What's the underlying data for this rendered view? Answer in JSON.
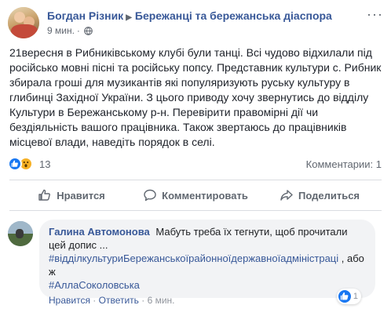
{
  "post": {
    "author": "Богдан Різник",
    "group": "Бережанці та бережанська діаспора",
    "time": "9 мин.",
    "text": "21вересня в Рибниківському клубі були танці. Всі чудово відхилали під російсько мовні пісні та російську попсу. Представник культури с. Рибник збирала гроші для музикантів які популяризують руську культуру в глибинці Західної України. З цього приводу хочу звернутись до відділу Культури в Бережанському р-н. Перевірити правомірні дії чи бездіяльність вашого працівника. Також звертаюсь до працівників місцевої влади, наведіть порядок в селі.",
    "reaction_count": "13",
    "comments_label": "Комментарии: 1"
  },
  "actions": {
    "like": "Нравится",
    "comment": "Комментировать",
    "share": "Поделиться"
  },
  "comment": {
    "author": "Галина Автомонова",
    "text": "Мабуть треба їх тегнути, щоб прочитали цей допис ...",
    "hashtag1": "#відділкультуриБережанськоїрайонноїдержавноїадміністраці",
    "text2": " , або ж",
    "hashtag2": "#АллаСоколовська",
    "like_link": "Нравится",
    "reply_link": "Ответить",
    "time": "6 мин.",
    "reaction_count": "1",
    "sep": " · "
  },
  "colors": {
    "link": "#385898",
    "meta": "#616770",
    "like_blue": "#1877f2",
    "wow_yellow": "#f7b125"
  },
  "icons": [
    "globe-icon",
    "like-reaction-icon",
    "wow-reaction-icon",
    "thumb-up-icon",
    "comment-icon",
    "share-icon",
    "more-options-icon"
  ]
}
